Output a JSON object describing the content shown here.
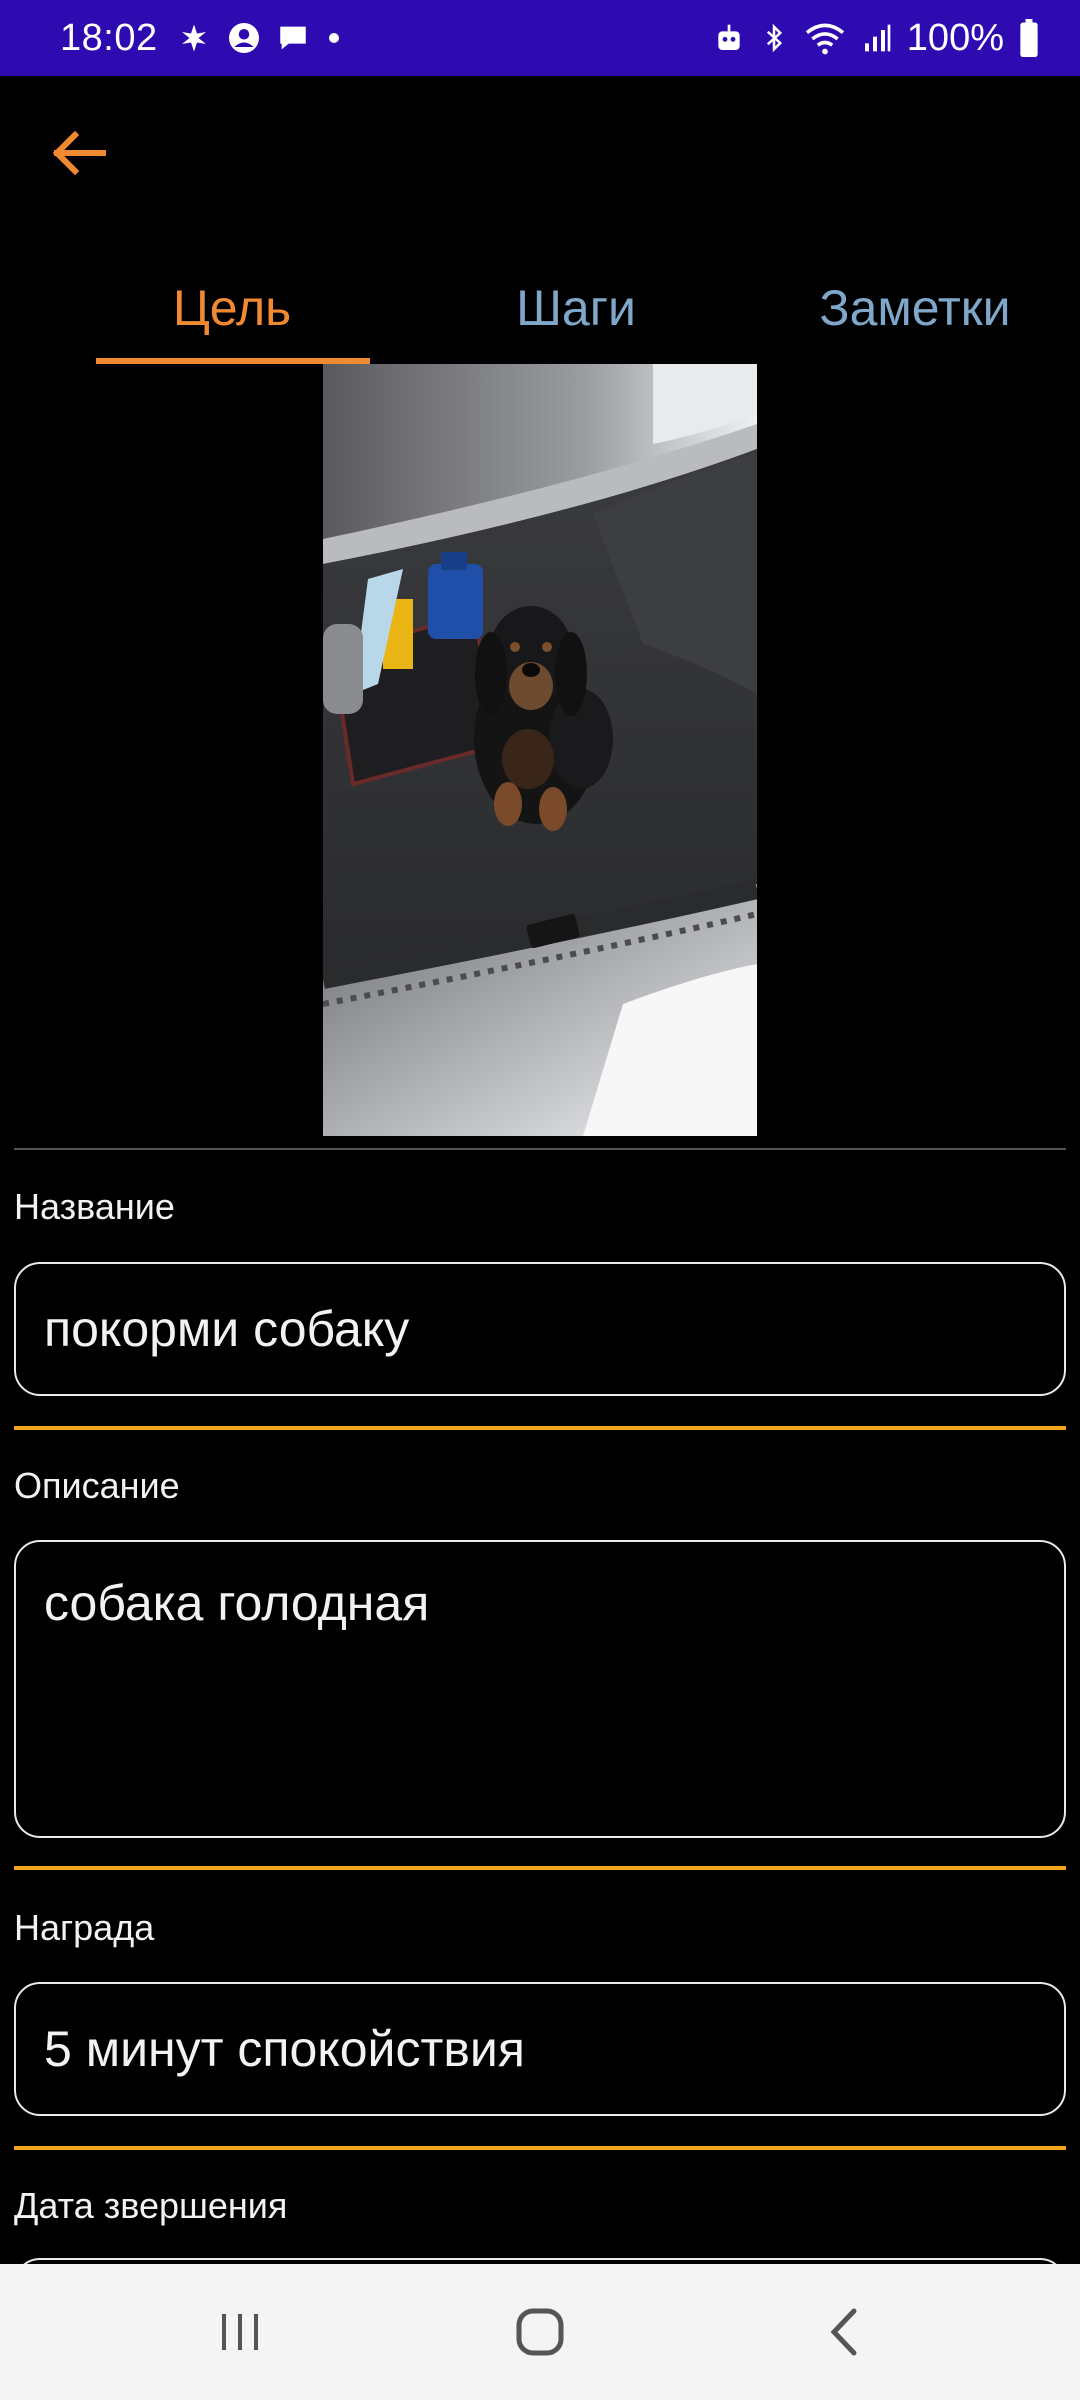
{
  "status_bar": {
    "time": "18:02",
    "battery": "100%",
    "left_icons": [
      "pinwheel-icon",
      "account-circle-icon",
      "chat-bubble-icon",
      "dot-icon"
    ],
    "right_icons": [
      "robot-icon",
      "bluetooth-icon",
      "wifi-icon",
      "signal-icon",
      "battery-icon"
    ],
    "background": "#2e0bb0"
  },
  "app_bar": {
    "back_icon": "arrow-left-icon",
    "accent": "#f08a32"
  },
  "tabs": [
    {
      "label": "Цель",
      "selected": true
    },
    {
      "label": "Шаги",
      "selected": false
    },
    {
      "label": "Заметки",
      "selected": false
    }
  ],
  "photo": {
    "subject": "dachshund-in-car-trunk"
  },
  "form": {
    "name": {
      "label": "Название",
      "value": "покорми собаку"
    },
    "description": {
      "label": "Описание",
      "value": "собака голодная"
    },
    "reward": {
      "label": "Награда",
      "value": "5 минут спокойствия"
    },
    "due_date": {
      "label": "Дата звершения",
      "value": ""
    }
  },
  "nav_bar": {
    "buttons": [
      "recents-icon",
      "home-icon",
      "back-icon"
    ]
  },
  "colors": {
    "tab_selected": "#f08a32",
    "tab_unselected": "#7fa7c9",
    "divider": "#f2a71a"
  }
}
